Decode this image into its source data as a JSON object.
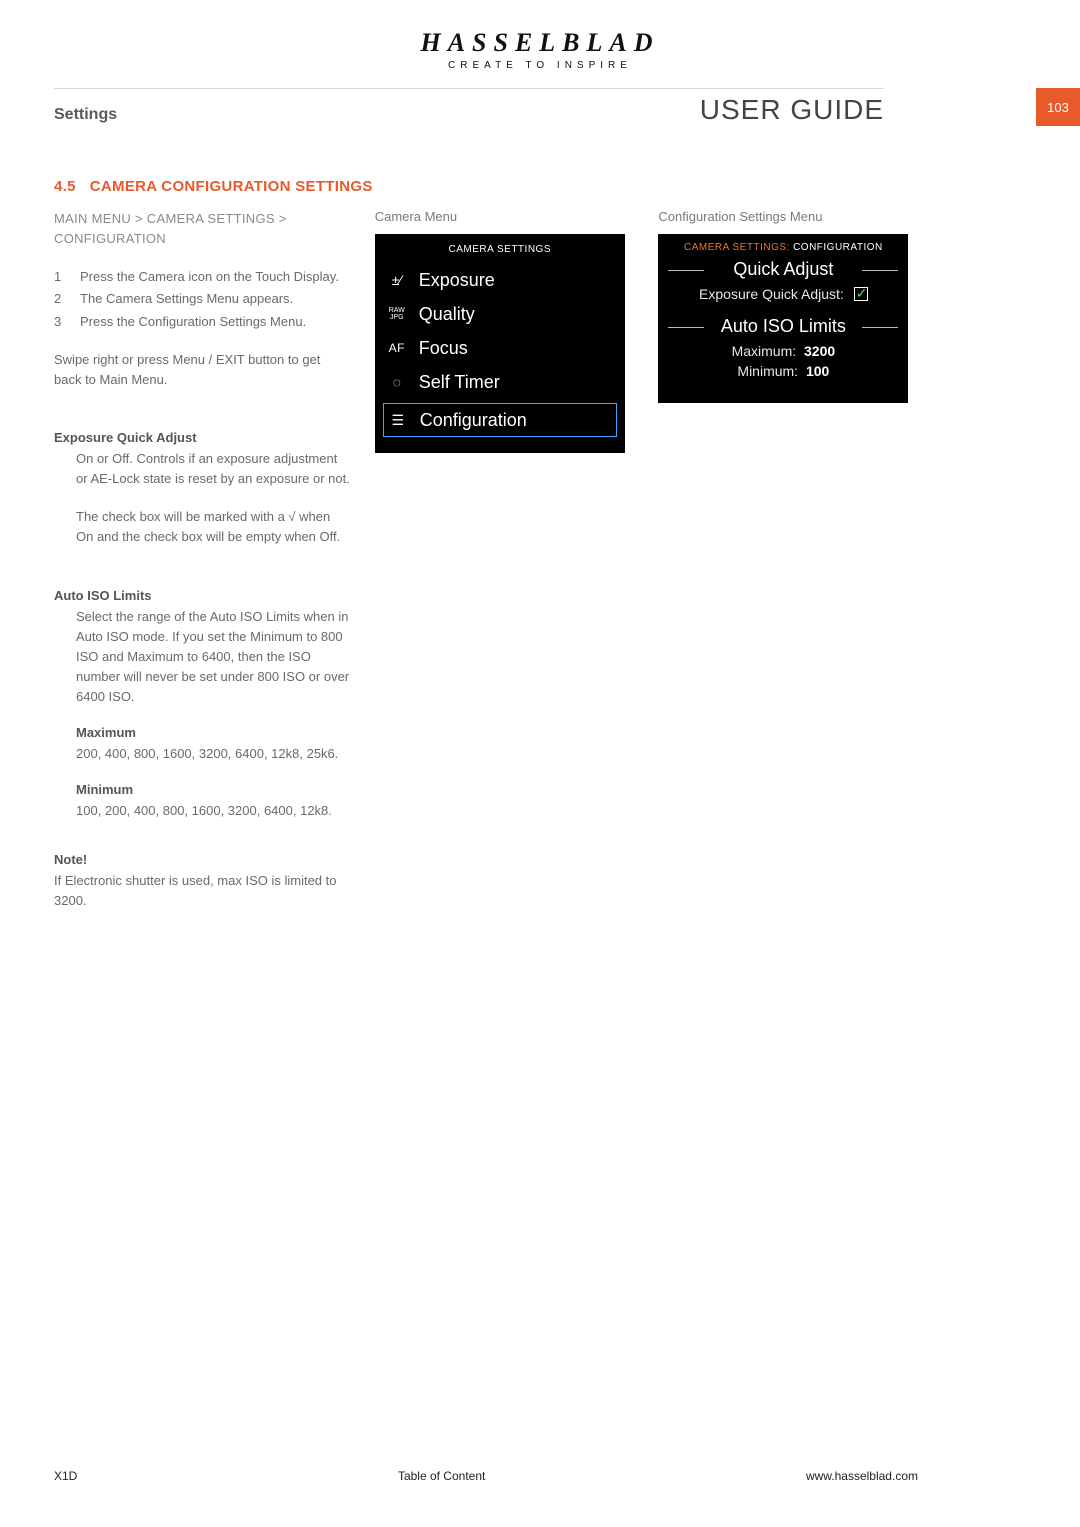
{
  "brand": {
    "name": "HASSELBLAD",
    "tag": "CREATE TO INSPIRE"
  },
  "header": {
    "section": "Settings",
    "doc_type": "USER GUIDE",
    "page_no": "103"
  },
  "section": {
    "number": "4.5",
    "title": "CAMERA CONFIGURATION SETTINGS"
  },
  "breadcrumb": "MAIN MENU > CAMERA SETTINGS > CONFIGURATION",
  "steps": [
    {
      "n": "1",
      "t": "Press the Camera icon on the Touch Display."
    },
    {
      "n": "2",
      "t": "The Camera Settings Menu appears."
    },
    {
      "n": "3",
      "t": "Press the Configuration Settings Menu."
    }
  ],
  "swipe_note": "Swipe right or press Menu / EXIT button to get back to Main Menu.",
  "eqa": {
    "heading": "Exposure Quick Adjust",
    "p1": "On or Off. Controls if an exposure adjustment or AE-Lock state is reset by an exposure or not.",
    "p2": "The check box will be marked with a √ when On and the check box will be empty when Off."
  },
  "ail": {
    "heading": "Auto ISO Limits",
    "p1": "Select the range of the Auto ISO Limits when in Auto ISO mode. If you set the Minimum to 800 ISO and Maximum to 6400, then the ISO number will never be set under 800 ISO or over 6400 ISO.",
    "max_h": "Maximum",
    "max_v": "200, 400, 800, 1600, 3200, 6400, 12k8, 25k6.",
    "min_h": "Minimum",
    "min_v": "100, 200, 400, 800, 1600, 3200, 6400, 12k8."
  },
  "note": {
    "heading": "Note!",
    "body": "If Electronic shutter is used, max ISO is limited to 3200."
  },
  "camera_menu": {
    "caption": "Camera Menu",
    "title": "CAMERA SETTINGS",
    "items": [
      {
        "icon": "exposure-comp-icon",
        "glyph": "±⁄",
        "label": "Exposure"
      },
      {
        "icon": "raw-jpg-icon",
        "glyph": "RAW\nJPG",
        "label": "Quality"
      },
      {
        "icon": "af-icon",
        "glyph": "AF",
        "label": "Focus"
      },
      {
        "icon": "self-timer-icon",
        "glyph": "◌",
        "label": "Self Timer"
      },
      {
        "icon": "sliders-icon",
        "glyph": "☰",
        "label": "Configuration"
      }
    ],
    "selected_index": 4
  },
  "config_menu": {
    "caption": "Configuration Settings Menu",
    "title_prefix": "CAMERA SETTINGS:",
    "title_suffix": "CONFIGURATION",
    "quick_adjust_heading": "Quick Adjust",
    "eqa_label": "Exposure Quick Adjust:",
    "eqa_checked": true,
    "auto_iso_heading": "Auto ISO Limits",
    "max_label": "Maximum:",
    "max_value": "3200",
    "min_label": "Minimum:",
    "min_value": "100"
  },
  "footer": {
    "model": "X1D",
    "toc": "Table of Content",
    "url": "www.hasselblad.com"
  }
}
